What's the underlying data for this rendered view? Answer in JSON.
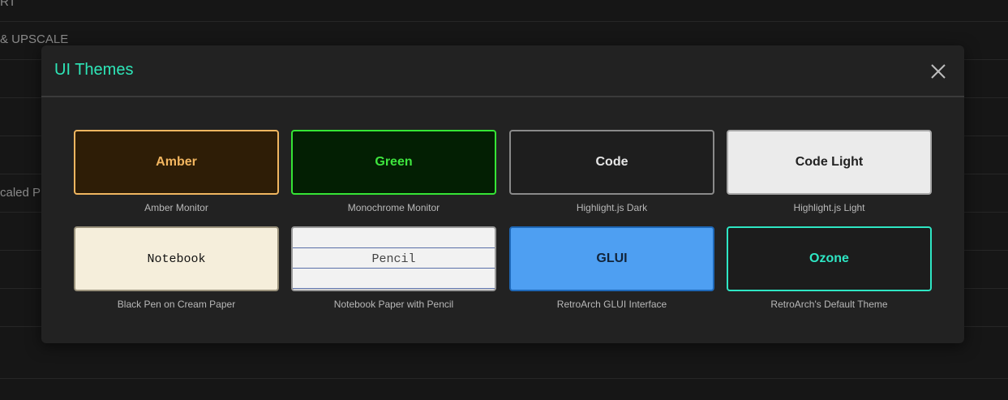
{
  "background": {
    "rows": [
      {
        "label": "RT"
      },
      {
        "label": "& UPSCALE"
      },
      {
        "label": ""
      },
      {
        "label": ""
      },
      {
        "label": ""
      },
      {
        "label": "caled P"
      },
      {
        "label": ""
      },
      {
        "label": ""
      },
      {
        "label": ""
      },
      {
        "label": ""
      }
    ]
  },
  "modal": {
    "title": "UI Themes",
    "close_icon": "close-icon",
    "themes": [
      {
        "name": "Amber",
        "description": "Amber Monitor",
        "border": "#f0b660",
        "background": "#2e1d06"
      },
      {
        "name": "Green",
        "description": "Monochrome Monitor",
        "border": "#35e535",
        "background": "#031f03"
      },
      {
        "name": "Code",
        "description": "Highlight.js Dark",
        "border": "#8a8a8a",
        "background": "#1e1e1e"
      },
      {
        "name": "Code Light",
        "description": "Highlight.js Light",
        "border": "#a8a8a8",
        "background": "#ebebeb"
      },
      {
        "name": "Notebook",
        "description": "Black Pen on Cream Paper",
        "border": "#9a927c",
        "background": "#f5eedb"
      },
      {
        "name": "Pencil",
        "description": "Notebook Paper with Pencil",
        "border": "#9a9a9a",
        "background": "#f2f2f2"
      },
      {
        "name": "GLUI",
        "description": "RetroArch GLUI Interface",
        "border": "#1e68b8",
        "background": "#4e9ff2"
      },
      {
        "name": "Ozone",
        "description": "RetroArch's Default Theme",
        "border": "#2ee6c4",
        "background": "#1c1c1c"
      }
    ]
  },
  "colors": {
    "accent": "#2ee6b8",
    "modal_background": "#222222",
    "page_background": "#161616"
  }
}
